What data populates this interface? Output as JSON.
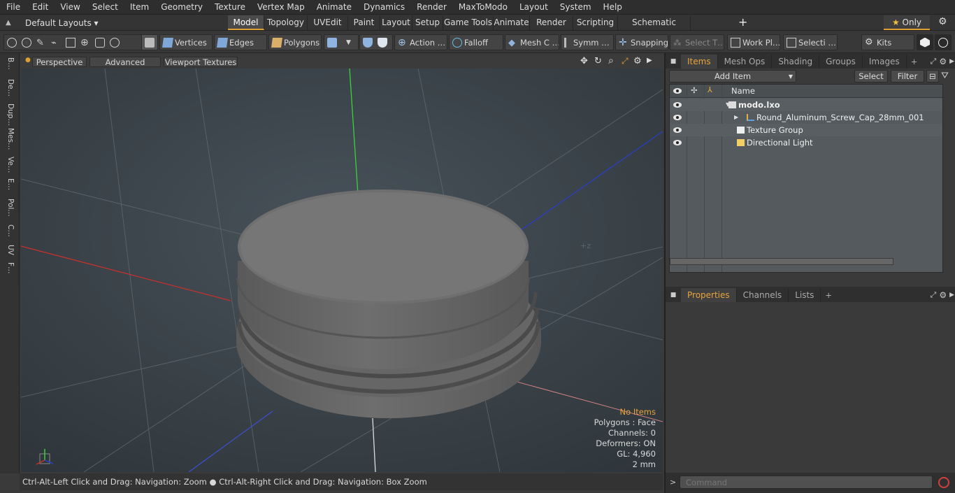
{
  "menu": [
    "File",
    "Edit",
    "View",
    "Select",
    "Item",
    "Geometry",
    "Texture",
    "Vertex Map",
    "Animate",
    "Dynamics",
    "Render",
    "MaxToModo",
    "Layout",
    "System",
    "Help"
  ],
  "layouts_label": "Default Layouts",
  "layout_tabs": [
    "Model",
    "Topology",
    "UVEdit",
    "Paint",
    "Layout",
    "Setup",
    "Game Tools",
    "Animate",
    "Render",
    "Scripting",
    "Schematic Fusion"
  ],
  "active_layout_tab": "Model",
  "only_label": "Only",
  "toolbar": {
    "vertices": "Vertices",
    "edges": "Edges",
    "polygons": "Polygons",
    "action": "Action …",
    "falloff": "Falloff",
    "mesh_c": "Mesh C …",
    "symm": "Symm …",
    "snapping": "Snapping",
    "select_t": "Select T…",
    "work_pl": "Work Pl…",
    "selecti": "Selecti …",
    "kits": "Kits"
  },
  "left_tabs": [
    "B…",
    "De…",
    "Dup…",
    "Mes…",
    "Ve…",
    "E…",
    "Pol…",
    "C…",
    "UV",
    "F…"
  ],
  "viewport": {
    "perspective": "Perspective",
    "advanced": "Advanced",
    "viewport_textures": "Viewport Textures",
    "no_items": "No Items",
    "polygons": "Polygons : Face",
    "channels": "Channels: 0",
    "deformers": "Deformers: ON",
    "gl": "GL: 4,960",
    "scale": "2 mm"
  },
  "status_text": "Ctrl-Alt-Left Click and Drag: Navigation: Zoom ● Ctrl-Alt-Right Click and Drag: Navigation: Box Zoom",
  "items_panel": {
    "tabs": [
      "Items",
      "Mesh Ops",
      "Shading",
      "Groups",
      "Images"
    ],
    "add_item": "Add Item",
    "select": "Select",
    "filter": "Filter",
    "name_header": "Name",
    "rows": [
      {
        "label": "modo.lxo",
        "icon": "scene-icon"
      },
      {
        "label": "Round_Aluminum_Screw_Cap_28mm_001",
        "icon": "mesh-icon"
      },
      {
        "label": "Texture Group",
        "icon": "texture-group-icon"
      },
      {
        "label": "Directional Light",
        "icon": "light-icon"
      }
    ]
  },
  "props_panel": {
    "tabs": [
      "Properties",
      "Channels",
      "Lists"
    ]
  },
  "command_placeholder": "Command",
  "colors": {
    "accent": "#e8a33a",
    "x_axis": "#c8302b",
    "y_axis": "#3bd03b",
    "z_axis": "#2a3fc0"
  }
}
